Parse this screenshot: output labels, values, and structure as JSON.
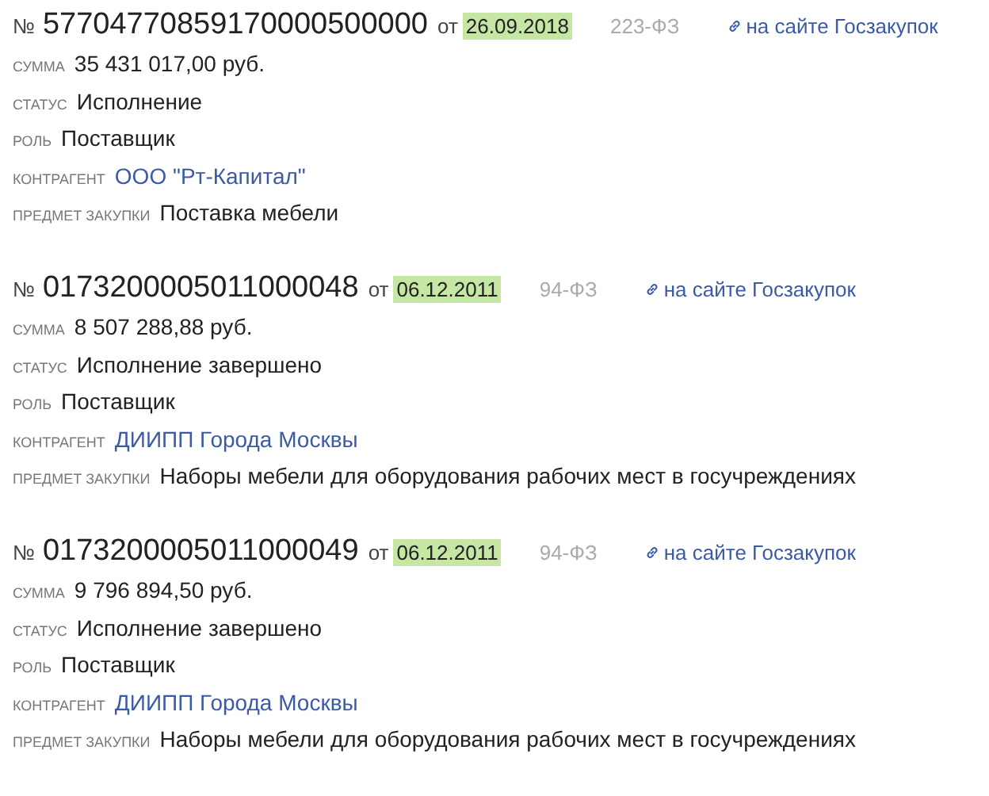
{
  "contracts": [
    {
      "number_sign": "№",
      "number": "57704770859170000500000",
      "from": "от",
      "date": "26.09.2018",
      "law": "223-ФЗ",
      "link": "на сайте Госзакупок",
      "fields": [
        {
          "label": "СУММА",
          "value": "35 431 017,00 руб.",
          "kind": "text"
        },
        {
          "label": "СТАТУС",
          "value": "Исполнение",
          "kind": "text"
        },
        {
          "label": "РОЛЬ",
          "value": "Поставщик",
          "kind": "text"
        },
        {
          "label": "КОНТРАГЕНТ",
          "value": "ООО \"Рт-Капитал\"",
          "kind": "link"
        },
        {
          "label": "ПРЕДМЕТ ЗАКУПКИ",
          "value": "Поставка мебели",
          "kind": "text"
        }
      ]
    },
    {
      "number_sign": "№",
      "number": "0173200005011000048",
      "from": "от",
      "date": "06.12.2011",
      "law": "94-ФЗ",
      "link": "на сайте Госзакупок",
      "fields": [
        {
          "label": "СУММА",
          "value": "8 507 288,88 руб.",
          "kind": "text"
        },
        {
          "label": "СТАТУС",
          "value": "Исполнение завершено",
          "kind": "text"
        },
        {
          "label": "РОЛЬ",
          "value": "Поставщик",
          "kind": "text"
        },
        {
          "label": "КОНТРАГЕНТ",
          "value": "ДИИПП Города Москвы",
          "kind": "link"
        },
        {
          "label": "ПРЕДМЕТ ЗАКУПКИ",
          "value": "Наборы мебели для оборудования рабочих мест в госучреждениях",
          "kind": "text"
        }
      ]
    },
    {
      "number_sign": "№",
      "number": "0173200005011000049",
      "from": "от",
      "date": "06.12.2011",
      "law": "94-ФЗ",
      "link": "на сайте Госзакупок",
      "fields": [
        {
          "label": "СУММА",
          "value": "9 796 894,50 руб.",
          "kind": "text"
        },
        {
          "label": "СТАТУС",
          "value": "Исполнение завершено",
          "kind": "text"
        },
        {
          "label": "РОЛЬ",
          "value": "Поставщик",
          "kind": "text"
        },
        {
          "label": "КОНТРАГЕНТ",
          "value": "ДИИПП Города Москвы",
          "kind": "link"
        },
        {
          "label": "ПРЕДМЕТ ЗАКУПКИ",
          "value": "Наборы мебели для оборудования рабочих мест в госучреждениях",
          "kind": "text"
        }
      ]
    }
  ]
}
